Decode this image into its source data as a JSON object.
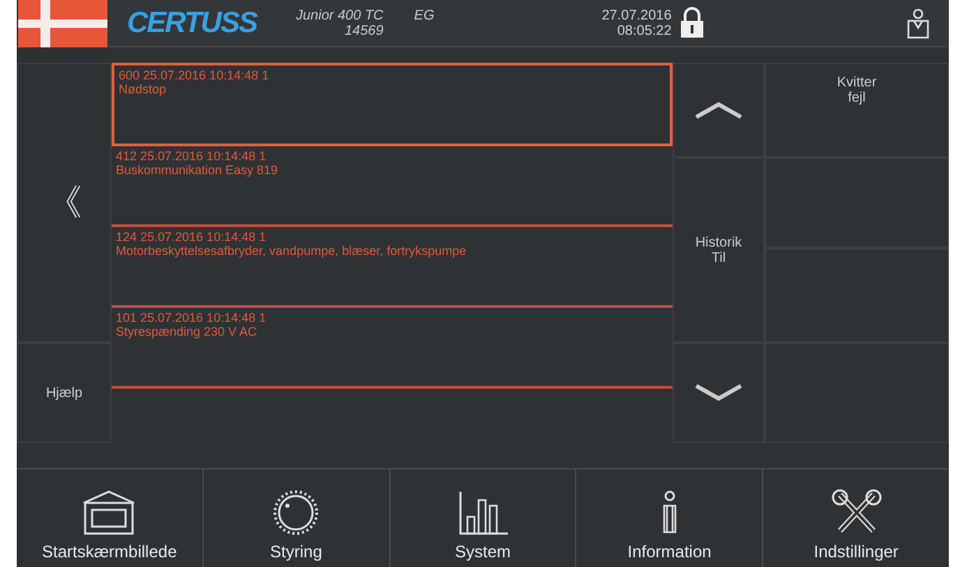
{
  "header": {
    "logo": "CERTUSS",
    "model": "Junior 400 TC",
    "location": "EG",
    "serial": "14569",
    "date": "27.07.2016",
    "time": "08:05:22",
    "locked": true
  },
  "alarms": [
    {
      "code": "600 25.07.2016 10:14:48 1",
      "text": "Nødstop",
      "selected": true
    },
    {
      "code": "412 25.07.2016 10:14:48 1",
      "text": "Buskommunikation Easy 819",
      "selected": false
    },
    {
      "code": "124 25.07.2016 10:14:48 1",
      "text": "Motorbeskyttelsesafbryder, vandpumpe, blæser, fortrykspumpe",
      "selected": false
    },
    {
      "code": "101 25.07.2016 10:14:48 1",
      "text": "Styrespænding 230 V AC",
      "selected": false
    }
  ],
  "side_buttons": {
    "back": "《",
    "help": "Hjælp",
    "history": "Historik\nTil",
    "acknowledge": "Kvitter\nfejl"
  },
  "nav": [
    {
      "label": "Startskærmbillede",
      "kind": "home"
    },
    {
      "label": "Styring",
      "kind": "dial"
    },
    {
      "label": "System",
      "kind": "chart"
    },
    {
      "label": "Information",
      "kind": "info"
    },
    {
      "label": "Indstillinger",
      "kind": "tools"
    }
  ]
}
